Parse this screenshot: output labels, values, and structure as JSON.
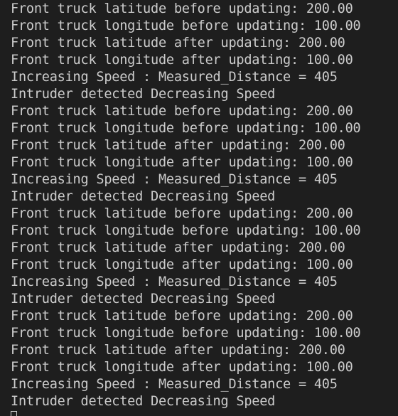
{
  "terminal": {
    "lines": [
      "Front truck latitude before updating: 200.00",
      "Front truck longitude before updating: 100.00",
      "Front truck latitude after updating: 200.00",
      "Front truck longitude after updating: 100.00",
      "Increasing Speed : Measured_Distance = 405",
      "Intruder detected Decreasing Speed",
      "Front truck latitude before updating: 200.00",
      "Front truck longitude before updating: 100.00",
      "Front truck latitude after updating: 200.00",
      "Front truck longitude after updating: 100.00",
      "Increasing Speed : Measured_Distance = 405",
      "Intruder detected Decreasing Speed",
      "Front truck latitude before updating: 200.00",
      "Front truck longitude before updating: 100.00",
      "Front truck latitude after updating: 200.00",
      "Front truck longitude after updating: 100.00",
      "Increasing Speed : Measured_Distance = 405",
      "Intruder detected Decreasing Speed",
      "Front truck latitude before updating: 200.00",
      "Front truck longitude before updating: 100.00",
      "Front truck latitude after updating: 200.00",
      "Front truck longitude after updating: 100.00",
      "Increasing Speed : Measured_Distance = 405",
      "Intruder detected Decreasing Speed"
    ],
    "colors": {
      "background": "#1e1e1e",
      "foreground": "#cccccc"
    }
  }
}
